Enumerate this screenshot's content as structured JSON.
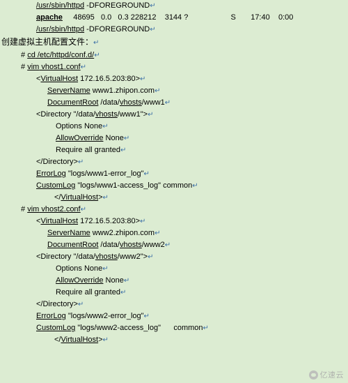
{
  "document": {
    "background_color": "#dcecd2",
    "pilcrow_glyph": "↵",
    "lines": [
      {
        "indent": 52,
        "segments": [
          {
            "text": "/usr/sbin/httpd",
            "underline": true
          },
          {
            "text": " -DFOREGROUND",
            "underline": false
          },
          {
            "text": "↵",
            "pilcrow": true
          }
        ]
      },
      {
        "indent": 52,
        "segments": [
          {
            "text": "apache",
            "underline": true,
            "bold": true
          },
          {
            "text": "     48695   0.0   0.3 228212    3144 ?                    S       17:40    0:00",
            "underline": false
          }
        ]
      },
      {
        "indent": 52,
        "segments": [
          {
            "text": "/usr/sbin/httpd",
            "underline": true
          },
          {
            "text": " -DFOREGROUND",
            "underline": false
          },
          {
            "text": "↵",
            "pilcrow": true
          }
        ]
      },
      {
        "indent": 2,
        "chinese": true,
        "segments": [
          {
            "text": "创建虚拟主机配置文件：",
            "underline": false
          },
          {
            "text": "↵",
            "pilcrow": true
          }
        ]
      },
      {
        "indent": 30,
        "segments": [
          {
            "text": "# ",
            "underline": false
          },
          {
            "text": "cd",
            "underline": true
          },
          {
            "text": " /etc/httpd/conf.d/",
            "underline": true
          },
          {
            "text": "↵",
            "pilcrow": true
          }
        ]
      },
      {
        "indent": 30,
        "segments": [
          {
            "text": "# ",
            "underline": false
          },
          {
            "text": "vim",
            "underline": true
          },
          {
            "text": " vhost1.conf",
            "underline": true
          },
          {
            "text": "↵",
            "pilcrow": true
          }
        ]
      },
      {
        "indent": 52,
        "segments": [
          {
            "text": "<",
            "underline": false
          },
          {
            "text": "VirtualHost",
            "underline": true
          },
          {
            "text": " 172.16.5.203:80>",
            "underline": false
          },
          {
            "text": "↵",
            "pilcrow": true
          }
        ]
      },
      {
        "indent": 68,
        "segments": [
          {
            "text": "ServerName",
            "underline": true
          },
          {
            "text": " www1.zhipon.com",
            "underline": false
          },
          {
            "text": "↵",
            "pilcrow": true
          }
        ]
      },
      {
        "indent": 68,
        "segments": [
          {
            "text": "DocumentRoot",
            "underline": true
          },
          {
            "text": " /data/",
            "underline": false
          },
          {
            "text": "vhosts",
            "underline": true
          },
          {
            "text": "/www1",
            "underline": false
          },
          {
            "text": "↵",
            "pilcrow": true
          }
        ]
      },
      {
        "indent": 52,
        "segments": [
          {
            "text": "<Directory \"/data/",
            "underline": false
          },
          {
            "text": "vhosts",
            "underline": true
          },
          {
            "text": "/www1\">",
            "underline": false
          },
          {
            "text": "↵",
            "pilcrow": true
          }
        ]
      },
      {
        "indent": 80,
        "segments": [
          {
            "text": "Options None",
            "underline": false
          },
          {
            "text": "↵",
            "pilcrow": true
          }
        ]
      },
      {
        "indent": 80,
        "segments": [
          {
            "text": "AllowOverride",
            "underline": true
          },
          {
            "text": " None",
            "underline": false
          },
          {
            "text": "↵",
            "pilcrow": true
          }
        ]
      },
      {
        "indent": 80,
        "segments": [
          {
            "text": "Require all granted",
            "underline": false
          },
          {
            "text": "↵",
            "pilcrow": true
          }
        ]
      },
      {
        "indent": 52,
        "segments": [
          {
            "text": "</Directory>",
            "underline": false
          },
          {
            "text": "↵",
            "pilcrow": true
          }
        ]
      },
      {
        "indent": 52,
        "segments": [
          {
            "text": "ErrorLog",
            "underline": true
          },
          {
            "text": " \"logs/www1-error_log\"",
            "underline": false
          },
          {
            "text": "↵",
            "pilcrow": true
          }
        ]
      },
      {
        "indent": 52,
        "segments": [
          {
            "text": "CustomLog",
            "underline": true
          },
          {
            "text": " \"logs/www1-access_log\" common",
            "underline": false
          },
          {
            "text": "↵",
            "pilcrow": true
          }
        ]
      },
      {
        "indent": 78,
        "segments": [
          {
            "text": "</",
            "underline": false
          },
          {
            "text": "VirtualHost",
            "underline": true
          },
          {
            "text": ">",
            "underline": false
          },
          {
            "text": "↵",
            "pilcrow": true
          }
        ]
      },
      {
        "indent": 30,
        "segments": [
          {
            "text": "# ",
            "underline": false
          },
          {
            "text": "vim",
            "underline": true
          },
          {
            "text": " vhost2.conf",
            "underline": true
          },
          {
            "text": "↵",
            "pilcrow": true
          }
        ]
      },
      {
        "indent": 52,
        "segments": [
          {
            "text": "<",
            "underline": false
          },
          {
            "text": "VirtualHost",
            "underline": true
          },
          {
            "text": " 172.16.5.203:80>",
            "underline": false
          },
          {
            "text": "↵",
            "pilcrow": true
          }
        ]
      },
      {
        "indent": 68,
        "segments": [
          {
            "text": "ServerName",
            "underline": true
          },
          {
            "text": " www2.zhipon.com",
            "underline": false
          },
          {
            "text": "↵",
            "pilcrow": true
          }
        ]
      },
      {
        "indent": 68,
        "segments": [
          {
            "text": "DocumentRoot",
            "underline": true
          },
          {
            "text": " /data/",
            "underline": false
          },
          {
            "text": "vhosts",
            "underline": true
          },
          {
            "text": "/www2",
            "underline": false
          },
          {
            "text": "↵",
            "pilcrow": true
          }
        ]
      },
      {
        "indent": 52,
        "segments": [
          {
            "text": "<Directory \"/data/",
            "underline": false
          },
          {
            "text": "vhosts",
            "underline": true
          },
          {
            "text": "/www2\">",
            "underline": false
          },
          {
            "text": "↵",
            "pilcrow": true
          }
        ]
      },
      {
        "indent": 80,
        "segments": [
          {
            "text": "Options None",
            "underline": false
          },
          {
            "text": "↵",
            "pilcrow": true
          }
        ]
      },
      {
        "indent": 80,
        "segments": [
          {
            "text": "AllowOverride",
            "underline": true
          },
          {
            "text": " None",
            "underline": false
          },
          {
            "text": "↵",
            "pilcrow": true
          }
        ]
      },
      {
        "indent": 80,
        "segments": [
          {
            "text": "Require all granted",
            "underline": false
          },
          {
            "text": "↵",
            "pilcrow": true
          }
        ]
      },
      {
        "indent": 52,
        "segments": [
          {
            "text": "</Directory>",
            "underline": false
          },
          {
            "text": "↵",
            "pilcrow": true
          }
        ]
      },
      {
        "indent": 52,
        "segments": [
          {
            "text": "ErrorLog",
            "underline": true
          },
          {
            "text": " \"logs/www2-error_log\"",
            "underline": false
          },
          {
            "text": "↵",
            "pilcrow": true
          }
        ]
      },
      {
        "indent": 52,
        "segments": [
          {
            "text": "CustomLog",
            "underline": true
          },
          {
            "text": " \"logs/www2-access_log\"      common",
            "underline": false
          },
          {
            "text": "↵",
            "pilcrow": true
          }
        ]
      },
      {
        "indent": 78,
        "segments": [
          {
            "text": "</",
            "underline": false
          },
          {
            "text": "VirtualHost",
            "underline": true
          },
          {
            "text": ">",
            "underline": false
          },
          {
            "text": "↵",
            "pilcrow": true
          }
        ]
      }
    ]
  },
  "watermark": {
    "label": "亿速云",
    "icon": "cloud-icon"
  }
}
